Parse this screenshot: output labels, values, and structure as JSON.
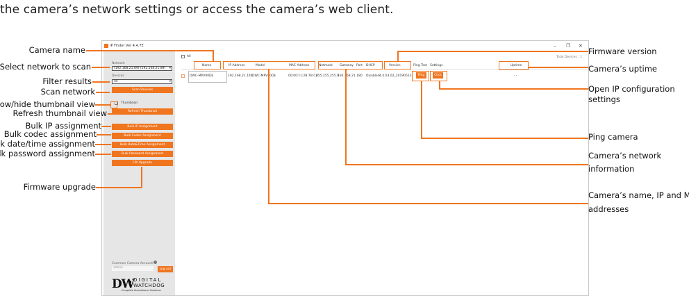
{
  "caption": "the camera’s network settings or access the camera’s web client.",
  "left_labels": {
    "camera_name": "Camera  name",
    "select_network": "Select network to scan",
    "filter_results": "Filter results",
    "scan_network": "Scan network",
    "show_hide_thumbnail": "Show/hide thumbnail view",
    "refresh_thumbnail": "Refresh thumbnail view",
    "bulk_ip": "Bulk IP assignment",
    "bulk_codec": "Bulk codec assignment",
    "bulk_datetime": "Bulk date/time assignment",
    "bulk_password": "Bulk password assignment",
    "firmware_upgrade": "Firmware upgrade"
  },
  "right_labels": {
    "firmware_version": "Firmware version",
    "uptime": "Camera’s uptime",
    "open_ip_config_1": "Open IP configuration",
    "open_ip_config_2": "settings",
    "ping_camera": "Ping camera",
    "network_info_1": "Camera’s network",
    "network_info_2": "information",
    "name_ip_mac_1": "Camera’s name, IP and MAC",
    "name_ip_mac_2": "addresses"
  },
  "app": {
    "title": "IP Finder Ver 4.4.7E",
    "win_min": "–",
    "win_max": "❐",
    "win_close": "✕",
    "network_label": "Network",
    "network_value": "[192.168.21.89] [192.168.21.89]",
    "devices_label": "Devices",
    "devices_value": "All",
    "scan_devices": "Scan Devices",
    "thumbnail": "Thumbnail",
    "refresh_thumbnail": "Refresh Thumbnail",
    "bulk_ip": "Bulk IP Assignment",
    "bulk_codec": "Bulk Codec Assignment",
    "bulk_datetime": "Bulk Date&Time Assignment",
    "bulk_password": "Bulk Password Assignment",
    "fw_upgrade": "FW Upgrade",
    "common_account": "Common Camera Account",
    "admin": "admin",
    "log_out": "Log out",
    "logo_main": "DIGITAL",
    "logo_sub": "WATCHDOG",
    "logo_tag": "Complete Surveillance Solutions",
    "all": "All",
    "total_devices": "Total Devices : 1"
  },
  "table": {
    "headers": [
      "Name",
      "IP Address",
      "Model",
      "MAC Address",
      "Netmask",
      "Gateway",
      "Port",
      "DHCP",
      "Version",
      "Ping Test",
      "Settings",
      "Uptime"
    ],
    "row": {
      "name": "DWC-MPV00DE",
      "ip": "192.168.21.144",
      "model": "DWC-MPV00DE",
      "mac": "00:00:F1:2B:7B:CB",
      "netmask": "255.255.255.0",
      "gateway": "192.168.21.1",
      "port": "80",
      "dhcp": "Disabled",
      "version": "4.4.03.02_20190513",
      "ping": "Ping",
      "settings": "Click",
      "uptime": "- -"
    }
  }
}
